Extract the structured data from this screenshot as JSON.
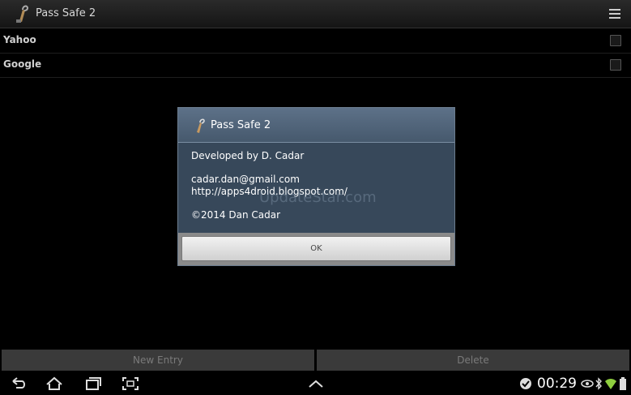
{
  "action_bar": {
    "title": "Pass Safe 2"
  },
  "list": {
    "items": [
      {
        "label": "Yahoo"
      },
      {
        "label": "Google"
      }
    ]
  },
  "dialog": {
    "title": "Pass Safe 2",
    "developed_by": "Developed by D. Cadar",
    "email": "cadar.dan@gmail.com",
    "website": "http://apps4droid.blogspot.com/",
    "copyright": "©2014 Dan Cadar",
    "ok_label": "OK"
  },
  "watermark": "UpdateStar.com",
  "bottom_buttons": {
    "new_entry": "New Entry",
    "delete": "Delete"
  },
  "status_bar": {
    "time": "00:29"
  },
  "colors": {
    "dialog_bg": "#37485a",
    "dialog_header": "#52667c",
    "action_bar": "#1e1e1e"
  },
  "icons": [
    "app-icon",
    "overflow-menu-icon",
    "back-icon",
    "home-icon",
    "recent-apps-icon",
    "screenshot-icon",
    "chevron-up-icon",
    "notification-icon",
    "eye-icon",
    "bluetooth-icon",
    "wifi-icon",
    "battery-icon"
  ]
}
